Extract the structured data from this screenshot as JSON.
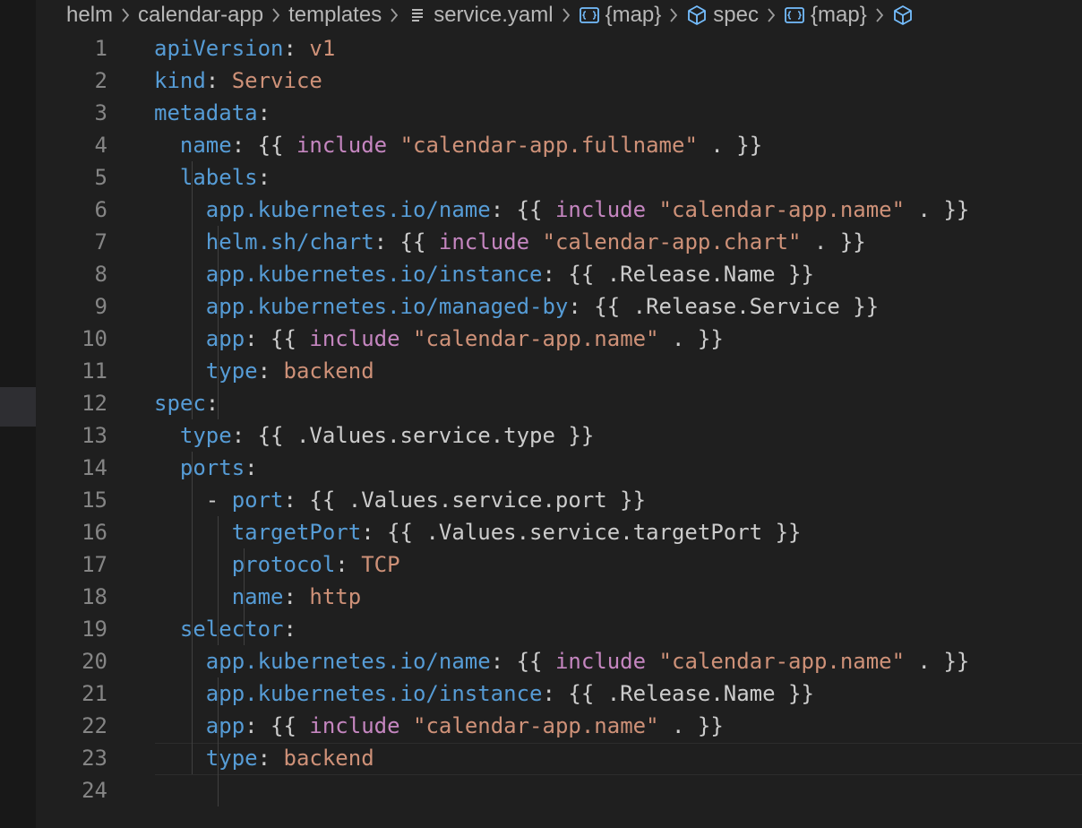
{
  "breadcrumb": {
    "items": [
      {
        "label": "helm",
        "icon": ""
      },
      {
        "label": "calendar-app",
        "icon": ""
      },
      {
        "label": "templates",
        "icon": ""
      },
      {
        "label": "service.yaml",
        "icon": "file-lines-icon"
      },
      {
        "label": "{map}",
        "icon": "object-braces-icon"
      },
      {
        "label": "spec",
        "icon": "cube-icon"
      },
      {
        "label": "{map}",
        "icon": "object-braces-icon"
      },
      {
        "label": "",
        "icon": "cube-icon"
      }
    ]
  },
  "editor": {
    "colors": {
      "key": "#569cd6",
      "string": "#ce9178",
      "keyword": "#c586c0",
      "plain": "#cccccc",
      "line_number": "#858585"
    },
    "lines": [
      {
        "n": "1",
        "tokens": [
          [
            "k",
            "apiVersion"
          ],
          [
            "p",
            ": "
          ],
          [
            "s",
            "v1"
          ]
        ]
      },
      {
        "n": "2",
        "tokens": [
          [
            "k",
            "kind"
          ],
          [
            "p",
            ": "
          ],
          [
            "s",
            "Service"
          ]
        ]
      },
      {
        "n": "3",
        "tokens": [
          [
            "k",
            "metadata"
          ],
          [
            "p",
            ":"
          ]
        ]
      },
      {
        "n": "4",
        "tokens": [
          [
            "p",
            "  "
          ],
          [
            "k",
            "name"
          ],
          [
            "p",
            ": {{ "
          ],
          [
            "f",
            "include"
          ],
          [
            "p",
            " "
          ],
          [
            "s",
            "\"calendar-app.fullname\""
          ],
          [
            "p",
            " . }}"
          ]
        ]
      },
      {
        "n": "5",
        "tokens": [
          [
            "p",
            "  "
          ],
          [
            "k",
            "labels"
          ],
          [
            "p",
            ":"
          ]
        ]
      },
      {
        "n": "6",
        "tokens": [
          [
            "p",
            "    "
          ],
          [
            "k",
            "app.kubernetes.io/name"
          ],
          [
            "p",
            ": {{ "
          ],
          [
            "f",
            "include"
          ],
          [
            "p",
            " "
          ],
          [
            "s",
            "\"calendar-app.name\""
          ],
          [
            "p",
            " . }}"
          ]
        ]
      },
      {
        "n": "7",
        "tokens": [
          [
            "p",
            "    "
          ],
          [
            "k",
            "helm.sh/chart"
          ],
          [
            "p",
            ": {{ "
          ],
          [
            "f",
            "include"
          ],
          [
            "p",
            " "
          ],
          [
            "s",
            "\"calendar-app.chart\""
          ],
          [
            "p",
            " . }}"
          ]
        ]
      },
      {
        "n": "8",
        "tokens": [
          [
            "p",
            "    "
          ],
          [
            "k",
            "app.kubernetes.io/instance"
          ],
          [
            "p",
            ": {{ .Release.Name }}"
          ]
        ]
      },
      {
        "n": "9",
        "tokens": [
          [
            "p",
            "    "
          ],
          [
            "k",
            "app.kubernetes.io/managed-by"
          ],
          [
            "p",
            ": {{ .Release.Service }}"
          ]
        ]
      },
      {
        "n": "10",
        "tokens": [
          [
            "p",
            "    "
          ],
          [
            "k",
            "app"
          ],
          [
            "p",
            ": {{ "
          ],
          [
            "f",
            "include"
          ],
          [
            "p",
            " "
          ],
          [
            "s",
            "\"calendar-app.name\""
          ],
          [
            "p",
            " . }}"
          ]
        ]
      },
      {
        "n": "11",
        "tokens": [
          [
            "p",
            "    "
          ],
          [
            "k",
            "type"
          ],
          [
            "p",
            ": "
          ],
          [
            "s",
            "backend"
          ]
        ]
      },
      {
        "n": "12",
        "tokens": [
          [
            "k",
            "spec"
          ],
          [
            "p",
            ":"
          ]
        ]
      },
      {
        "n": "13",
        "tokens": [
          [
            "p",
            "  "
          ],
          [
            "k",
            "type"
          ],
          [
            "p",
            ": {{ .Values.service.type }}"
          ]
        ]
      },
      {
        "n": "14",
        "tokens": [
          [
            "p",
            "  "
          ],
          [
            "k",
            "ports"
          ],
          [
            "p",
            ":"
          ]
        ]
      },
      {
        "n": "15",
        "tokens": [
          [
            "p",
            "    - "
          ],
          [
            "k",
            "port"
          ],
          [
            "p",
            ": {{ .Values.service.port }}"
          ]
        ]
      },
      {
        "n": "16",
        "tokens": [
          [
            "p",
            "      "
          ],
          [
            "k",
            "targetPort"
          ],
          [
            "p",
            ": {{ .Values.service.targetPort }}"
          ]
        ]
      },
      {
        "n": "17",
        "tokens": [
          [
            "p",
            "      "
          ],
          [
            "k",
            "protocol"
          ],
          [
            "p",
            ": "
          ],
          [
            "s",
            "TCP"
          ]
        ]
      },
      {
        "n": "18",
        "tokens": [
          [
            "p",
            "      "
          ],
          [
            "k",
            "name"
          ],
          [
            "p",
            ": "
          ],
          [
            "s",
            "http"
          ]
        ]
      },
      {
        "n": "19",
        "tokens": [
          [
            "p",
            "  "
          ],
          [
            "k",
            "selector"
          ],
          [
            "p",
            ":"
          ]
        ]
      },
      {
        "n": "20",
        "tokens": [
          [
            "p",
            "    "
          ],
          [
            "k",
            "app.kubernetes.io/name"
          ],
          [
            "p",
            ": {{ "
          ],
          [
            "f",
            "include"
          ],
          [
            "p",
            " "
          ],
          [
            "s",
            "\"calendar-app.name\""
          ],
          [
            "p",
            " . }}"
          ]
        ]
      },
      {
        "n": "21",
        "tokens": [
          [
            "p",
            "    "
          ],
          [
            "k",
            "app.kubernetes.io/instance"
          ],
          [
            "p",
            ": {{ .Release.Name }}"
          ]
        ]
      },
      {
        "n": "22",
        "tokens": [
          [
            "p",
            "    "
          ],
          [
            "k",
            "app"
          ],
          [
            "p",
            ": {{ "
          ],
          [
            "f",
            "include"
          ],
          [
            "p",
            " "
          ],
          [
            "s",
            "\"calendar-app.name\""
          ],
          [
            "p",
            " . }}"
          ]
        ]
      },
      {
        "n": "23",
        "tokens": [
          [
            "p",
            "    "
          ],
          [
            "k",
            "type"
          ],
          [
            "p",
            ": "
          ],
          [
            "s",
            "backend"
          ]
        ]
      },
      {
        "n": "24",
        "tokens": []
      }
    ]
  }
}
